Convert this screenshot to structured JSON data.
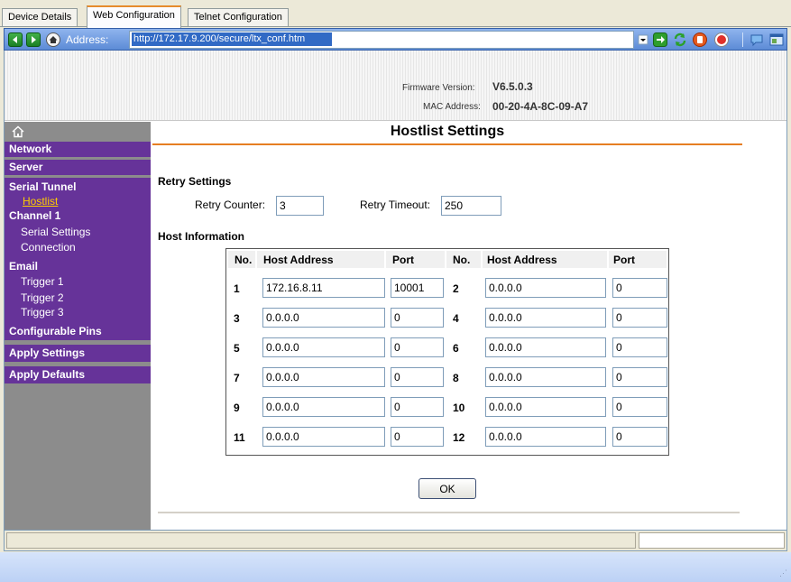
{
  "tabs": [
    {
      "label": "Device Details",
      "active": false
    },
    {
      "label": "Web Configuration",
      "active": true
    },
    {
      "label": "Telnet Configuration",
      "active": false
    }
  ],
  "address_bar": {
    "label": "Address:",
    "url": "http://172.17.9.200/secure/ltx_conf.htm",
    "icons": [
      "back-icon",
      "forward-icon",
      "home-icon",
      "go-icon",
      "refresh-icon",
      "stop-icon",
      "chat-icon",
      "window-icon"
    ]
  },
  "banner": {
    "firmware_label": "Firmware Version:",
    "firmware_value": "V6.5.0.3",
    "mac_label": "MAC Address:",
    "mac_value": "00-20-4A-8C-09-A7"
  },
  "sidebar": {
    "network": "Network",
    "server": "Server",
    "serial_tunnel": "Serial Tunnel",
    "hostlist": "Hostlist",
    "channel1": "Channel 1",
    "serial_settings": "Serial Settings",
    "connection": "Connection",
    "email": "Email",
    "trigger1": "Trigger 1",
    "trigger2": "Trigger 2",
    "trigger3": "Trigger 3",
    "configurable_pins": "Configurable Pins",
    "apply_settings": "Apply Settings",
    "apply_defaults": "Apply Defaults"
  },
  "content": {
    "title": "Hostlist Settings",
    "retry_section": "Retry Settings",
    "retry_counter_label": "Retry Counter:",
    "retry_counter_value": "3",
    "retry_timeout_label": "Retry Timeout:",
    "retry_timeout_value": "250",
    "host_section": "Host Information",
    "columns": {
      "no": "No.",
      "host": "Host Address",
      "port": "Port"
    },
    "hosts": [
      {
        "no": "1",
        "host": "172.16.8.11",
        "port": "10001"
      },
      {
        "no": "2",
        "host": "0.0.0.0",
        "port": "0"
      },
      {
        "no": "3",
        "host": "0.0.0.0",
        "port": "0"
      },
      {
        "no": "4",
        "host": "0.0.0.0",
        "port": "0"
      },
      {
        "no": "5",
        "host": "0.0.0.0",
        "port": "0"
      },
      {
        "no": "6",
        "host": "0.0.0.0",
        "port": "0"
      },
      {
        "no": "7",
        "host": "0.0.0.0",
        "port": "0"
      },
      {
        "no": "8",
        "host": "0.0.0.0",
        "port": "0"
      },
      {
        "no": "9",
        "host": "0.0.0.0",
        "port": "0"
      },
      {
        "no": "10",
        "host": "0.0.0.0",
        "port": "0"
      },
      {
        "no": "11",
        "host": "0.0.0.0",
        "port": "0"
      },
      {
        "no": "12",
        "host": "0.0.0.0",
        "port": "0"
      }
    ],
    "ok_label": "OK"
  },
  "colors": {
    "sidebar_purple": "#663399",
    "sidebar_gray": "#8c8c8c",
    "current_link": "#ffcc00",
    "title_rule": "#e67e22",
    "addressbar_blue": "#5c8bd6"
  }
}
